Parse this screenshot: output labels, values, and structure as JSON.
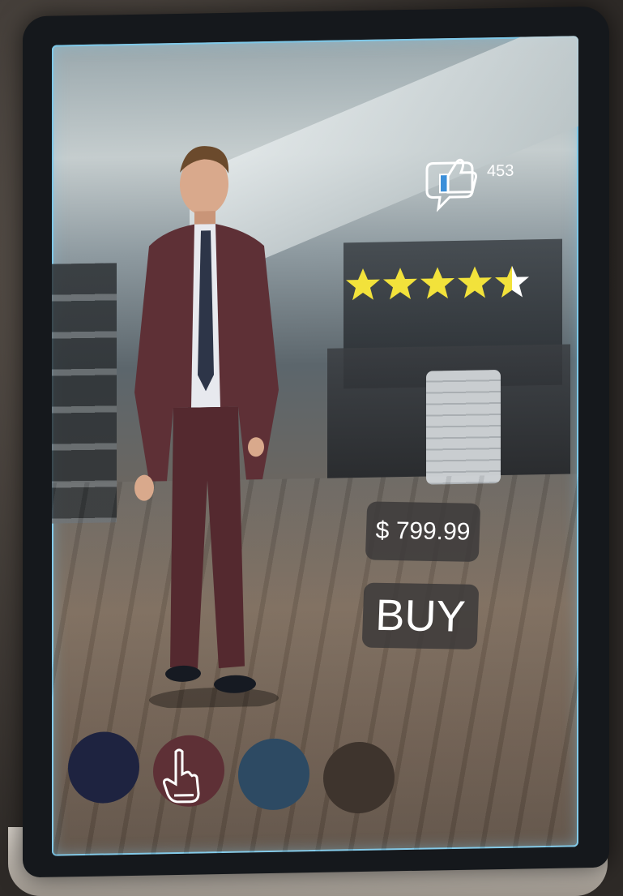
{
  "likes": {
    "icon": "thumbs-up-speech-bubble-icon",
    "count": "453"
  },
  "rating": {
    "value": 4.5,
    "max": 5,
    "star_color": "#f2e23b"
  },
  "price": {
    "text": "$ 799.99"
  },
  "buy_button": {
    "label": "BUY"
  },
  "color_options": [
    {
      "name": "navy",
      "color": "#1e2340",
      "selected": false
    },
    {
      "name": "burgundy",
      "color": "#5e3036",
      "selected": true
    },
    {
      "name": "steel-blue",
      "color": "#2d4a63",
      "selected": false
    },
    {
      "name": "brown",
      "color": "#3e342d",
      "selected": false
    }
  ],
  "colors": {
    "screen_glow": "#7ec8e8",
    "suit": "#5e3036",
    "tag_bg": "#3c3a3a"
  }
}
